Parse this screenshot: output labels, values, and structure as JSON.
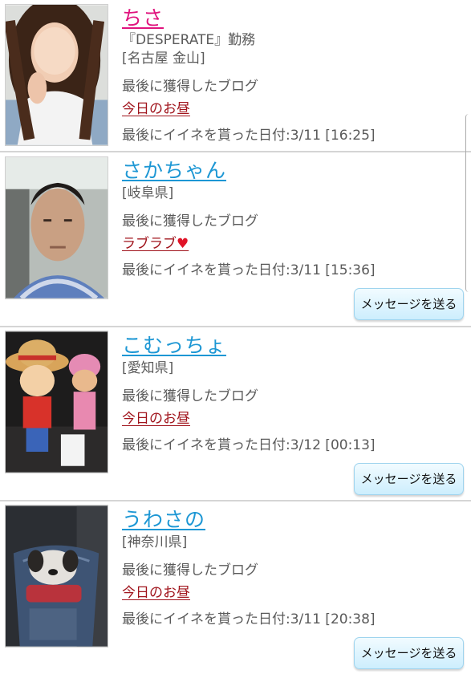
{
  "profiles": [
    {
      "name": "ちさ",
      "workplace": "『DESPERATE』勤務",
      "area": "[名古屋 金山]",
      "blog_heading": "最後に獲得したブログ",
      "blog_title": "今日のお昼",
      "last_like": "最後にイイネを貰った日付:3/11 [16:25]",
      "photo_icon": "woman-profile-photo"
    },
    {
      "name": "さかちゃん",
      "area": "[岐阜県]",
      "blog_heading": "最後に獲得したブログ",
      "blog_title": "ラブラブ",
      "blog_emoji": "♥",
      "last_like": "最後にイイネを貰った日付:3/11 [15:36]",
      "message_button": "メッセージを送る",
      "photo_icon": "man-in-car-photo"
    },
    {
      "name": "こむっちょ",
      "area": "[愛知県]",
      "blog_heading": "最後に獲得したブログ",
      "blog_title": "今日のお昼",
      "last_like": "最後にイイネを貰った日付:3/12 [00:13]",
      "message_button": "メッセージを送る",
      "photo_icon": "plush-toys-photo"
    },
    {
      "name": "うわさの",
      "area": "[神奈川県]",
      "blog_heading": "最後に獲得したブログ",
      "blog_title": "今日のお昼",
      "last_like": "最後にイイネを貰った日付:3/11 [20:38]",
      "message_button": "メッセージを送る",
      "photo_icon": "dog-in-bag-photo"
    }
  ],
  "colors": {
    "name_pink": "#e0147e",
    "name_blue": "#1d97d4",
    "blog_link": "#a0141c",
    "button_bg": "#cdeefd",
    "divider": "#d5d5d5"
  }
}
